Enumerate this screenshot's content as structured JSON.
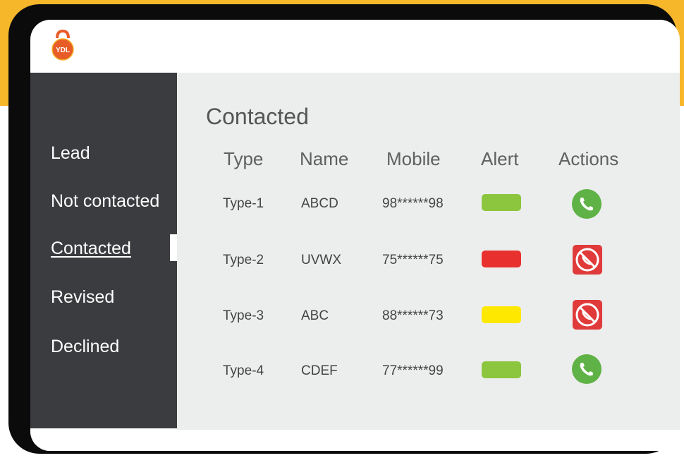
{
  "brand": {
    "logo_text": "YDL"
  },
  "sidebar": {
    "items": [
      {
        "label": "Lead",
        "active": false
      },
      {
        "label": "Not contacted",
        "active": false
      },
      {
        "label": "Contacted",
        "active": true
      },
      {
        "label": "Revised",
        "active": false
      },
      {
        "label": "Declined",
        "active": false
      }
    ]
  },
  "main": {
    "title": "Contacted",
    "columns": [
      "Type",
      "Name",
      "Mobile",
      "Alert",
      "Actions"
    ],
    "rows": [
      {
        "type": "Type-1",
        "name": "ABCD",
        "mobile": "98******98",
        "alert_color": "#8cc63f",
        "action_icon": "call-accept-icon"
      },
      {
        "type": "Type-2",
        "name": "UVWX",
        "mobile": "75******75",
        "alert_color": "#e8312f",
        "action_icon": "call-decline-icon"
      },
      {
        "type": "Type-3",
        "name": "ABC",
        "mobile": "88******73",
        "alert_color": "#ffe800",
        "action_icon": "call-decline-icon"
      },
      {
        "type": "Type-4",
        "name": "CDEF",
        "mobile": "77******99",
        "alert_color": "#8cc63f",
        "action_icon": "call-accept-icon"
      }
    ]
  },
  "colors": {
    "accent": "#f6b72b",
    "frame": "#0b0b0b",
    "sidebar_bg": "#3b3c3f",
    "main_bg": "#eceded",
    "call_green": "#5fb245",
    "decline_red": "#e03a3a"
  }
}
